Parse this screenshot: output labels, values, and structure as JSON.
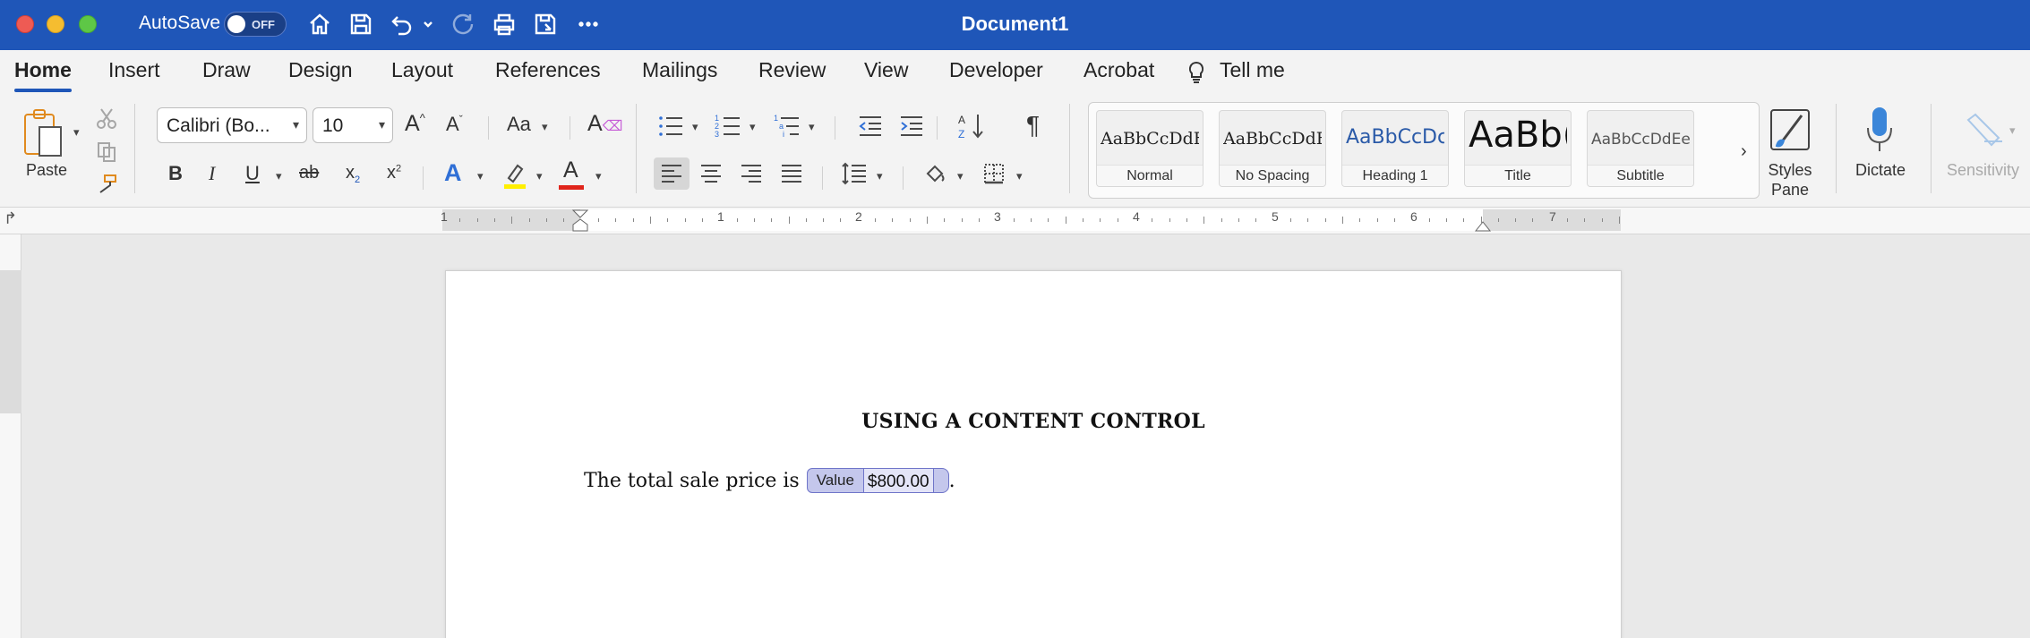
{
  "titlebar": {
    "autosave_label": "AutoSave",
    "autosave_state": "OFF",
    "document_title": "Document1"
  },
  "tabs": [
    "Home",
    "Insert",
    "Draw",
    "Design",
    "Layout",
    "References",
    "Mailings",
    "Review",
    "View",
    "Developer",
    "Acrobat"
  ],
  "tell_me": "Tell me",
  "ribbon": {
    "paste_label": "Paste",
    "font_name": "Calibri (Bo...",
    "font_size": "10",
    "styles": [
      {
        "preview": "AaBbCcDdEe",
        "name": "Normal"
      },
      {
        "preview": "AaBbCcDdEe",
        "name": "No Spacing"
      },
      {
        "preview": "AaBbCcDc",
        "name": "Heading 1"
      },
      {
        "preview": "AaBb(",
        "name": "Title"
      },
      {
        "preview": "AaBbCcDdEe",
        "name": "Subtitle"
      }
    ],
    "styles_pane_line1": "Styles",
    "styles_pane_line2": "Pane",
    "dictate_label": "Dictate",
    "sensitivity_label": "Sensitivity"
  },
  "ruler": {
    "numbers": [
      "1",
      "1",
      "2",
      "3",
      "4",
      "5",
      "6",
      "7"
    ]
  },
  "document": {
    "heading": "USING A CONTENT CONTROL",
    "sentence": "The total sale price is",
    "content_control_tag": "Value",
    "content_control_value": "$800.00",
    "trailing": "."
  },
  "colors": {
    "titlebar": "#1f56b8",
    "highlight_yellow": "#ffef00",
    "font_color_red": "#e0241b",
    "content_control": "#c4c7ec"
  }
}
